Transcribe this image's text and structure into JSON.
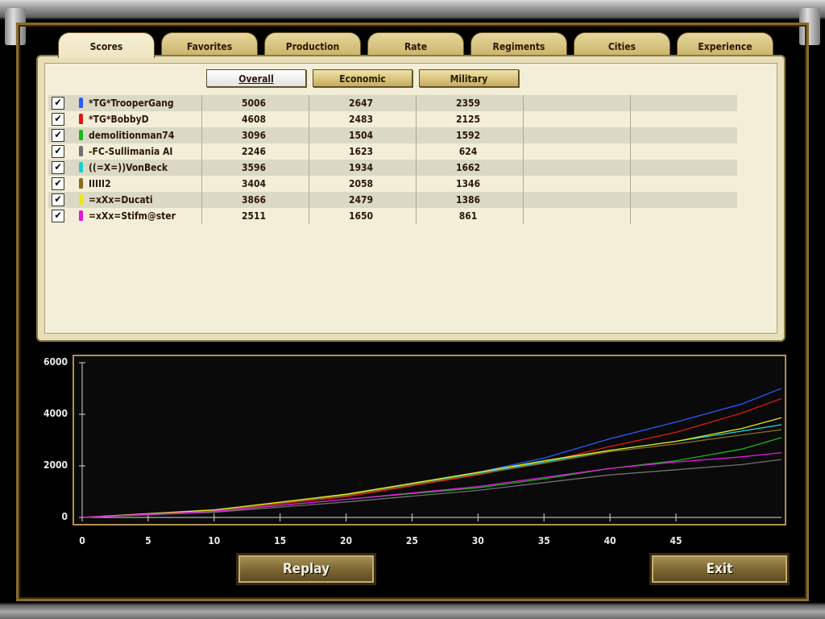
{
  "tabs": [
    "Scores",
    "Favorites",
    "Production",
    "Rate",
    "Regiments",
    "Cities",
    "Experience"
  ],
  "active_tab": "Scores",
  "sort_buttons": [
    "Overall",
    "Economic",
    "Military"
  ],
  "active_sort": "Overall",
  "players": [
    {
      "name": "*TG*TrooperGang",
      "color": "#2a5bff",
      "overall": "5006",
      "economic": "2647",
      "military": "2359",
      "checked": true
    },
    {
      "name": "*TG*BobbyD",
      "color": "#e01818",
      "overall": "4608",
      "economic": "2483",
      "military": "2125",
      "checked": true
    },
    {
      "name": "demolitionman74",
      "color": "#18b818",
      "overall": "3096",
      "economic": "1504",
      "military": "1592",
      "checked": true
    },
    {
      "name": "-FC-Sullimania AI",
      "color": "#707070",
      "overall": "2246",
      "economic": "1623",
      "military": "624",
      "checked": true
    },
    {
      "name": "((=X=))VonBeck",
      "color": "#18d0d0",
      "overall": "3596",
      "economic": "1934",
      "military": "1662",
      "checked": true
    },
    {
      "name": "IIIII2",
      "color": "#8a6a20",
      "overall": "3404",
      "economic": "2058",
      "military": "1346",
      "checked": true
    },
    {
      "name": "=xXx=Ducati",
      "color": "#e8e818",
      "overall": "3866",
      "economic": "2479",
      "military": "1386",
      "checked": true
    },
    {
      "name": "=xXx=Stifm@ster",
      "color": "#e018e0",
      "overall": "2511",
      "economic": "1650",
      "military": "861",
      "checked": true
    }
  ],
  "buttons": {
    "replay": "Replay",
    "exit": "Exit"
  },
  "chart_data": {
    "type": "line",
    "xlim": [
      0,
      53
    ],
    "ylim": [
      0,
      6000
    ],
    "yticks": [
      0,
      2000,
      4000,
      6000
    ],
    "xticks": [
      0,
      5,
      10,
      15,
      20,
      25,
      30,
      35,
      40,
      45
    ],
    "grid": false,
    "series": [
      {
        "name": "*TG*TrooperGang",
        "color": "#2a5bff",
        "x": [
          0,
          10,
          20,
          30,
          35,
          40,
          45,
          50,
          53
        ],
        "values": [
          0,
          300,
          850,
          1750,
          2300,
          3050,
          3700,
          4400,
          5006
        ]
      },
      {
        "name": "*TG*BobbyD",
        "color": "#e01818",
        "x": [
          0,
          10,
          20,
          30,
          35,
          40,
          45,
          50,
          53
        ],
        "values": [
          0,
          260,
          800,
          1650,
          2150,
          2750,
          3300,
          4050,
          4608
        ]
      },
      {
        "name": "demolitionman74",
        "color": "#18b818",
        "x": [
          0,
          10,
          20,
          30,
          35,
          40,
          45,
          50,
          53
        ],
        "values": [
          0,
          230,
          700,
          1150,
          1500,
          1900,
          2200,
          2650,
          3096
        ]
      },
      {
        "name": "-FC-Sullimania AI",
        "color": "#707070",
        "x": [
          0,
          10,
          20,
          30,
          35,
          40,
          45,
          50,
          53
        ],
        "values": [
          0,
          200,
          600,
          1050,
          1350,
          1650,
          1850,
          2050,
          2246
        ]
      },
      {
        "name": "((=X=))VonBeck",
        "color": "#18d0d0",
        "x": [
          0,
          10,
          20,
          30,
          35,
          40,
          45,
          50,
          53
        ],
        "values": [
          0,
          280,
          880,
          1720,
          2150,
          2600,
          2950,
          3350,
          3596
        ]
      },
      {
        "name": "IIIII2",
        "color": "#8a6a20",
        "x": [
          0,
          10,
          20,
          30,
          35,
          40,
          45,
          50,
          53
        ],
        "values": [
          0,
          260,
          850,
          1680,
          2100,
          2550,
          2850,
          3200,
          3404
        ]
      },
      {
        "name": "=xXx=Ducati",
        "color": "#e8e818",
        "x": [
          0,
          10,
          20,
          30,
          35,
          40,
          45,
          50,
          53
        ],
        "values": [
          0,
          290,
          900,
          1750,
          2200,
          2600,
          2950,
          3450,
          3866
        ]
      },
      {
        "name": "=xXx=Stifm@ster",
        "color": "#e018e0",
        "x": [
          0,
          10,
          20,
          30,
          35,
          40,
          45,
          50,
          53
        ],
        "values": [
          0,
          240,
          700,
          1200,
          1550,
          1900,
          2150,
          2350,
          2511
        ]
      }
    ]
  }
}
